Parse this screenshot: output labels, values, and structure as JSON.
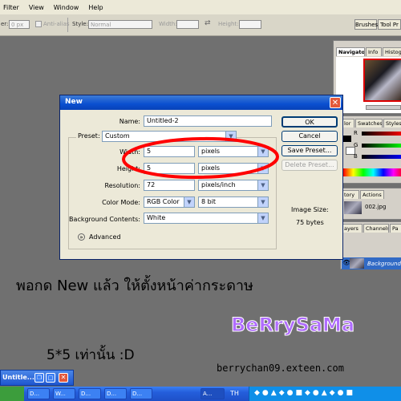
{
  "menu": [
    "Filter",
    "View",
    "Window",
    "Help"
  ],
  "options": {
    "feather_label": "er:",
    "feather_value": "0 px",
    "antialias_label": "Anti-alias",
    "style_label": "Style:",
    "style_value": "Normal",
    "width_label": "Width:",
    "height_label": "Height:",
    "tabs": [
      "Brushes",
      "Tool Pr"
    ]
  },
  "panels": {
    "navigator_tabs": [
      "Navigator",
      "Info",
      "Histog"
    ],
    "color_tabs": [
      "lor",
      "Swatches",
      "Styles"
    ],
    "color_channels": [
      "R",
      "G",
      "B"
    ],
    "history_tabs": [
      "tory",
      "Actions"
    ],
    "history_item": "002.jpg",
    "layers_tabs": [
      "ayers",
      "Channels",
      "Pa"
    ],
    "layer_name": "Background"
  },
  "dialog": {
    "title": "New",
    "name_label": "Name:",
    "name_value": "Untitled-2",
    "preset_label": "Preset:",
    "preset_value": "Custom",
    "width_label": "Width:",
    "width_value": "5",
    "width_unit": "pixels",
    "height_label": "Height:",
    "height_value": "5",
    "height_unit": "pixels",
    "resolution_label": "Resolution:",
    "resolution_value": "72",
    "resolution_unit": "pixels/inch",
    "colormode_label": "Color Mode:",
    "colormode_value": "RGB Color",
    "colormode_depth": "8 bit",
    "bg_label": "Background Contents:",
    "bg_value": "White",
    "advanced_label": "Advanced",
    "ok": "OK",
    "cancel": "Cancel",
    "save_preset": "Save Preset...",
    "delete_preset": "Delete Preset...",
    "image_size_label": "Image Size:",
    "image_size_value": "75 bytes"
  },
  "annotations": {
    "thai_caption": "พอกด New แล้ว ให้ตั้งหน้าค่ากระดาษ",
    "size_note": "5*5 เท่านั้น :D",
    "brand": "BeRrySaMa",
    "url": "berrychan09.exteen.com"
  },
  "minimized_window": "Untitle...",
  "taskbar": {
    "items": [
      "D...",
      "W...",
      "D...",
      "D...",
      "D...",
      "A..."
    ],
    "tray_text": "TH"
  },
  "colors": {
    "workspace": "#707070",
    "dialog_title": "#0a4fd0",
    "highlight_ring": "#ff0000",
    "brand_text": "#b06cff",
    "taskbar": "#245edb"
  }
}
